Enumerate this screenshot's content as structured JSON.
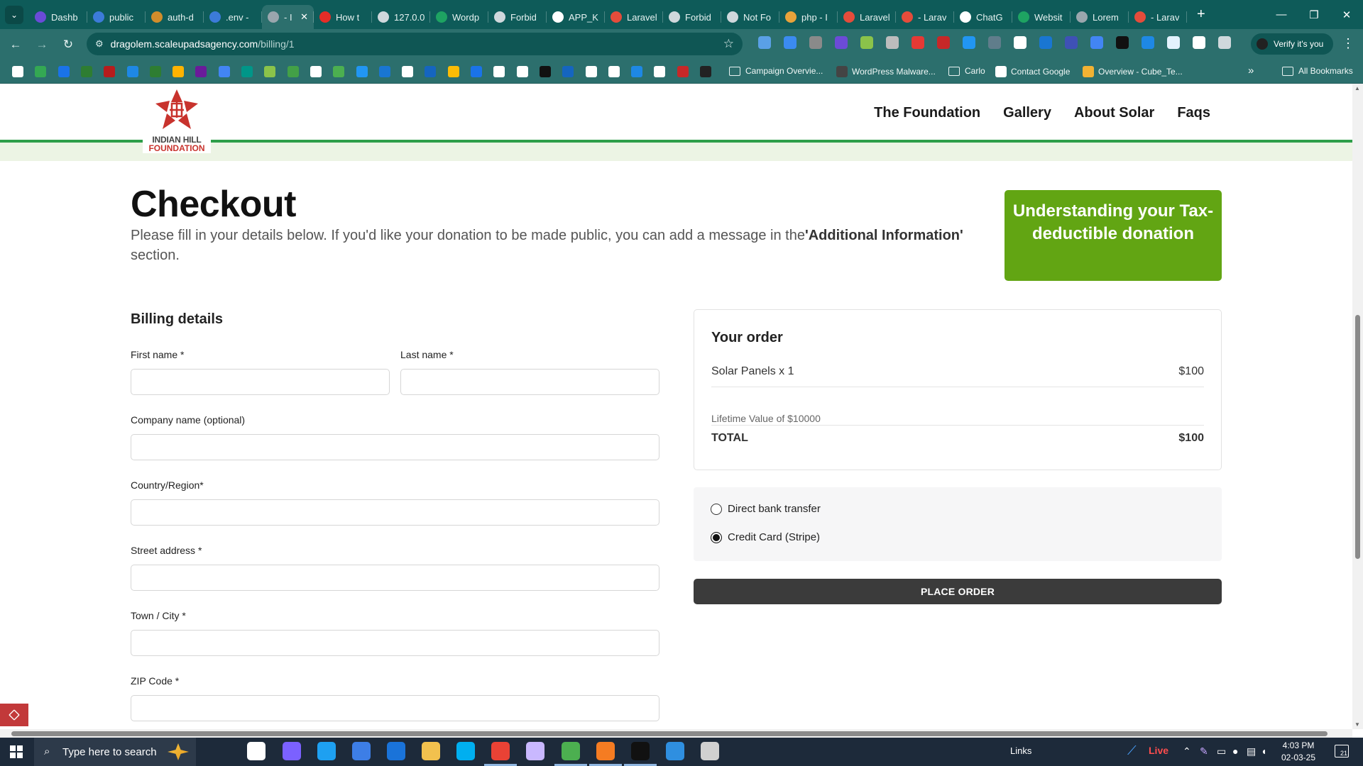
{
  "browser": {
    "tabs": [
      {
        "title": "Dashb",
        "icon_color": "#6a4bd8"
      },
      {
        "title": "public",
        "icon_color": "#3c7bd9"
      },
      {
        "title": "auth-d",
        "icon_color": "#d18d2b"
      },
      {
        "title": ".env -",
        "icon_color": "#3c7bd9"
      },
      {
        "title": "- I",
        "icon_color": "#9aa6ad",
        "active": true,
        "close": "✕"
      },
      {
        "title": "How t",
        "icon_color": "#e52d27"
      },
      {
        "title": "127.0.0",
        "icon_color": "#cfd8dc"
      },
      {
        "title": "Wordp",
        "icon_color": "#1ea362"
      },
      {
        "title": "Forbid",
        "icon_color": "#cfd8dc"
      },
      {
        "title": "APP_K",
        "icon_color": "#ffffff"
      },
      {
        "title": "Laravel",
        "icon_color": "#e44c3b"
      },
      {
        "title": "Forbid",
        "icon_color": "#cfd8dc"
      },
      {
        "title": "Not Fo",
        "icon_color": "#cfd8dc"
      },
      {
        "title": "php - I",
        "icon_color": "#e8a33b"
      },
      {
        "title": "Laravel",
        "icon_color": "#e44c3b"
      },
      {
        "title": "- Larav",
        "icon_color": "#e44c3b"
      },
      {
        "title": "ChatG",
        "icon_color": "#ffffff"
      },
      {
        "title": "Websit",
        "icon_color": "#1ea362"
      },
      {
        "title": "Lorem",
        "icon_color": "#9aa6ad"
      },
      {
        "title": "- Larav",
        "icon_color": "#e44c3b"
      }
    ],
    "new_tab": "+",
    "url_host": "dragolem.scaleupadsagency.com",
    "url_path": "/billing/1",
    "profile_label": "Verify it's you",
    "bookmarks": [
      {
        "label": "Campaign Overvie...",
        "type": "folder"
      },
      {
        "label": "WordPress Malware...",
        "type": "site",
        "icon_color": "#444444"
      },
      {
        "label": "Carlo",
        "type": "folder"
      },
      {
        "label": "Contact Google",
        "type": "site",
        "icon_color": "#ffffff"
      },
      {
        "label": "Overview - Cube_Te...",
        "type": "site",
        "icon_color": "#f2b233"
      }
    ],
    "more_bookmarks": "»",
    "all_bookmarks": "All Bookmarks"
  },
  "site": {
    "logo_line1": "INDIAN HILL",
    "logo_line2": "FOUNDATION",
    "nav": [
      "The Foundation",
      "Gallery",
      "About Solar",
      "Faqs"
    ]
  },
  "checkout": {
    "title": "Checkout",
    "intro_prefix": "Please fill in your details below. If you'd like your donation to be made public, you can add a message in the",
    "intro_bold": "'Additional Information'",
    "intro_suffix": " section.",
    "tax_button": "Understanding your Tax-deductible donation",
    "billing_title": "Billing details",
    "fields": {
      "first_name": "First name *",
      "last_name": "Last name *",
      "company": "Company name (optional)",
      "country": "Country/Region*",
      "street": "Street address *",
      "city": "Town / City *",
      "zip": "ZIP Code *"
    }
  },
  "order": {
    "title": "Your order",
    "item_label": "Solar Panels x 1",
    "item_price": "$100",
    "note": "Lifetime Value of $10000",
    "total_label": "TOTAL",
    "total_value": "$100"
  },
  "payment": {
    "options": [
      {
        "label": "Direct bank transfer",
        "selected": false
      },
      {
        "label": "Credit Card (Stripe)",
        "selected": true
      }
    ],
    "place_order": "PLACE ORDER"
  },
  "taskbar": {
    "search_placeholder": "Type here to search",
    "links": "Links",
    "live": "Live",
    "time": "4:03 PM",
    "date": "02-03-25",
    "notifications": "21"
  }
}
